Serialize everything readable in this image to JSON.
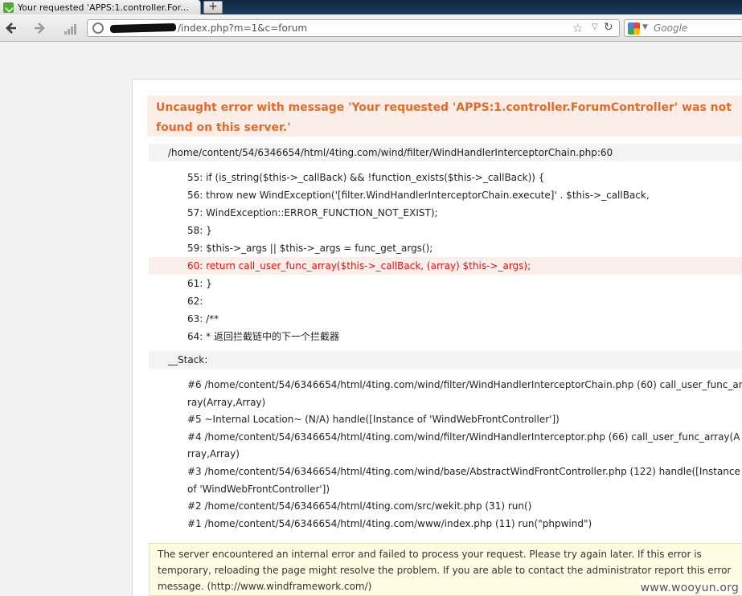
{
  "browser": {
    "tab_title": "Your requested 'APPS:1.controller.For...",
    "new_tab_label": "+",
    "url_visible": "/index.php?m=1&c=forum",
    "search_placeholder": "Google"
  },
  "error": {
    "title": "Uncaught error with message 'Your requested 'APPS:1.controller.ForumController' was not found on this server.'",
    "file": "/home/content/54/6346654/html/4ting.com/wind/filter/WindHandlerInterceptorChain.php:60",
    "code_lines": [
      "55: if (is_string($this->_callBack) && !function_exists($this->_callBack)) {",
      "56: throw new WindException('[filter.WindHandlerInterceptorChain.execute]' . $this->_callBack,",
      "57: WindException::ERROR_FUNCTION_NOT_EXIST);",
      "58: }",
      "59: $this->_args || $this->_args = func_get_args();",
      "60: return call_user_func_array($this->_callBack, (array) $this->_args);",
      "61: }",
      "62:",
      "63: /**",
      "64: * 返回拦截链中的下一个拦截器"
    ],
    "stack_label": "__Stack:",
    "stack_lines": [
      "#6 /home/content/54/6346654/html/4ting.com/wind/filter/WindHandlerInterceptorChain.php (60) call_user_func_array(Array,Array)",
      "#5 ~Internal Location~ (N/A) handle([Instance of 'WindWebFrontController'])",
      "#4 /home/content/54/6346654/html/4ting.com/wind/filter/WindHandlerInterceptor.php (66) call_user_func_array(Array,Array)",
      "#3 /home/content/54/6346654/html/4ting.com/wind/base/AbstractWindFrontController.php (122) handle([Instance of 'WindWebFrontController'])",
      "#2 /home/content/54/6346654/html/4ting.com/src/wekit.php (31) run()",
      "#1 /home/content/54/6346654/html/4ting.com/www/index.php (11) run(\"phpwind\")"
    ],
    "footer_message": "The server encountered an internal error and failed to process your request. Please try again later. If this error is temporary, reloading the page might resolve the problem. If you are able to contact the administrator report this error message. (http://www.windframework.com/)"
  },
  "watermark": "www.wooyun.org",
  "colors": {
    "title_text": "#e36b27",
    "title_bg": "#fbeee8",
    "highlight_text": "#e01010",
    "footer_bg": "#fefde4"
  }
}
